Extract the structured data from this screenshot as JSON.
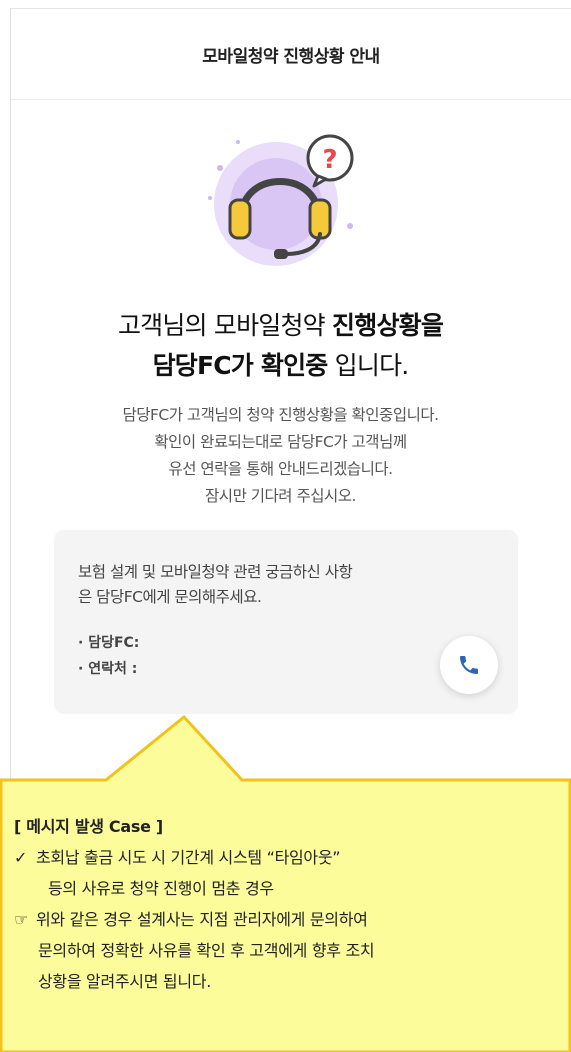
{
  "header": {
    "title": "모바일청약 진행상황 안내"
  },
  "headline": {
    "line1_normal": "고객님의 모바일청약 ",
    "line1_bold": "진행상황을",
    "line2_bold": "담당FC가 확인중",
    "line2_normal": " 입니다."
  },
  "description": {
    "lines": [
      "담당FC가 고객님의 청약 진행상황을 확인중입니다.",
      "확인이 완료되는대로 담당FC가 고객님께",
      "유선 연락을 통해 안내드리겠습니다.",
      "잠시만 기다려 주십시오."
    ]
  },
  "info_box": {
    "text_line1": "보험 설계 및 모바일청약 관련 궁금하신 사항",
    "text_line2": "은 담당FC에게 문의해주세요.",
    "fc_label": "· 담당FC:",
    "contact_label": "· 연락처 :",
    "call_icon": "phone-icon"
  },
  "callout": {
    "title": "[ 메시지 발생 Case ]",
    "check_mark": "✓",
    "case_line1": "초회납 출금 시도 시  기간계 시스템  “타임아웃”",
    "case_line2": "등의 사유로 청약 진행이  멈춘 경우",
    "pointer_mark": "☞",
    "note_line1": "위와 같은 경우 설계사는 지점 관리자에게 문의하여",
    "note_line2": "문의하여 정확한 사유를 확인 후 고객에게  향후 조치",
    "note_line3": "상황을 알려주시면 됩니다."
  },
  "colors": {
    "callout_fill": "#fdfc9a",
    "callout_border": "#f2c21b",
    "headset_yellow": "#f6c93b",
    "bubble_red": "#e8474b",
    "phone_blue": "#2f66b4"
  }
}
